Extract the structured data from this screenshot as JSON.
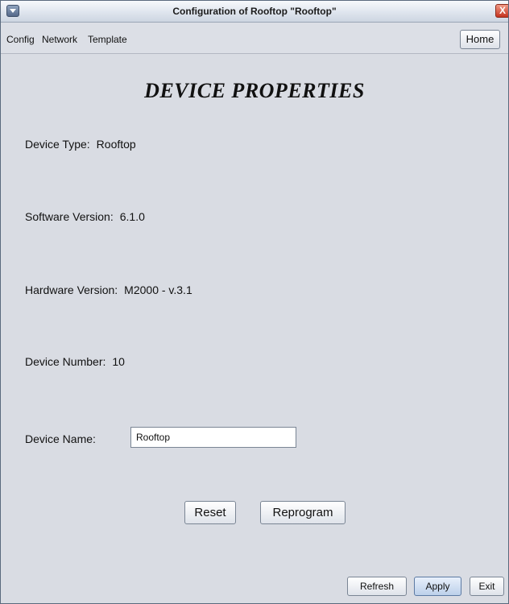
{
  "window": {
    "title": "Configuration of Rooftop \"Rooftop\"",
    "close_glyph": "X"
  },
  "menubar": {
    "items": [
      {
        "label": "Config"
      },
      {
        "label": "Network"
      },
      {
        "label": "Template"
      }
    ],
    "home_label": "Home"
  },
  "page": {
    "heading": "DEVICE PROPERTIES",
    "device_type": {
      "label": "Device Type:",
      "value": "Rooftop"
    },
    "software_version": {
      "label": "Software Version:",
      "value": "6.1.0"
    },
    "hardware_version": {
      "label": "Hardware Version:",
      "value": "M2000 - v.3.1"
    },
    "device_number": {
      "label": "Device Number:",
      "value": "10"
    },
    "device_name": {
      "label": "Device Name:",
      "value": "Rooftop"
    }
  },
  "actions": {
    "reset": "Reset",
    "reprogram": "Reprogram",
    "refresh": "Refresh",
    "apply": "Apply",
    "exit": "Exit"
  }
}
